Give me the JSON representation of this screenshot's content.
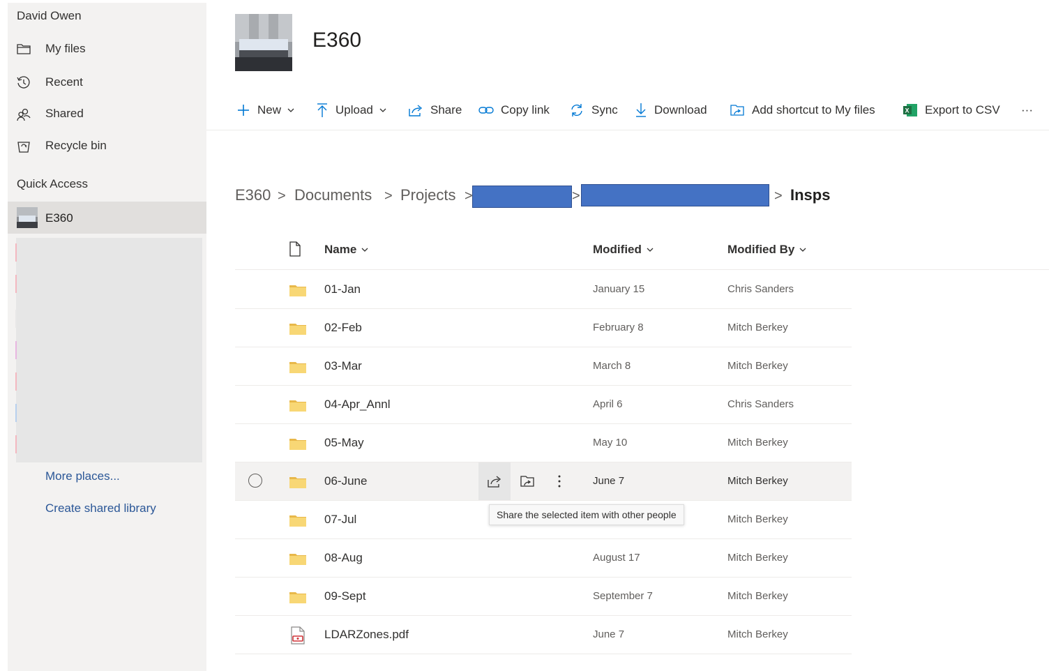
{
  "sidebar": {
    "user_name": "David Owen",
    "nav": [
      {
        "label": "My files",
        "icon": "folder-icon"
      },
      {
        "label": "Recent",
        "icon": "history-icon"
      },
      {
        "label": "Shared",
        "icon": "people-icon"
      },
      {
        "label": "Recycle bin",
        "icon": "recycle-bin-icon"
      }
    ],
    "quick_access_title": "Quick Access",
    "quick_access_item": "E360",
    "more_places": "More places...",
    "create_shared_library": "Create shared library"
  },
  "site": {
    "title": "E360"
  },
  "commands": {
    "new": "New",
    "upload": "Upload",
    "share": "Share",
    "copy_link": "Copy link",
    "sync": "Sync",
    "download": "Download",
    "add_shortcut": "Add shortcut to My files",
    "export_csv": "Export to CSV",
    "more": "···"
  },
  "breadcrumb": {
    "items": [
      "E360",
      "Documents",
      "Projects"
    ],
    "current": "Insps",
    "separator": ">"
  },
  "columns": {
    "name": "Name",
    "modified": "Modified",
    "modified_by": "Modified By"
  },
  "files": [
    {
      "name": "01-Jan",
      "modified": "January 15",
      "modified_by": "Chris Sanders",
      "type": "folder"
    },
    {
      "name": "02-Feb",
      "modified": "February 8",
      "modified_by": "Mitch Berkey",
      "type": "folder"
    },
    {
      "name": "03-Mar",
      "modified": "March 8",
      "modified_by": "Mitch Berkey",
      "type": "folder"
    },
    {
      "name": "04-Apr_Annl",
      "modified": "April 6",
      "modified_by": "Chris Sanders",
      "type": "folder"
    },
    {
      "name": "05-May",
      "modified": "May 10",
      "modified_by": "Mitch Berkey",
      "type": "folder"
    },
    {
      "name": "06-June",
      "modified": "June 7",
      "modified_by": "Mitch Berkey",
      "type": "folder"
    },
    {
      "name": "07-Jul",
      "modified": "",
      "modified_by": "Mitch Berkey",
      "type": "folder"
    },
    {
      "name": "08-Aug",
      "modified": "August 17",
      "modified_by": "Mitch Berkey",
      "type": "folder"
    },
    {
      "name": "09-Sept",
      "modified": "September 7",
      "modified_by": "Mitch Berkey",
      "type": "folder"
    },
    {
      "name": "LDARZones.pdf",
      "modified": "June 7",
      "modified_by": "Mitch Berkey",
      "type": "pdf"
    }
  ],
  "tooltip": "Share the selected item with other people",
  "colors": {
    "sidebar_bg": "#f3f2f1",
    "link": "#2b5797",
    "folder": "#f8d775",
    "redaction": "#4472c4",
    "excel": "#1d6f42"
  }
}
